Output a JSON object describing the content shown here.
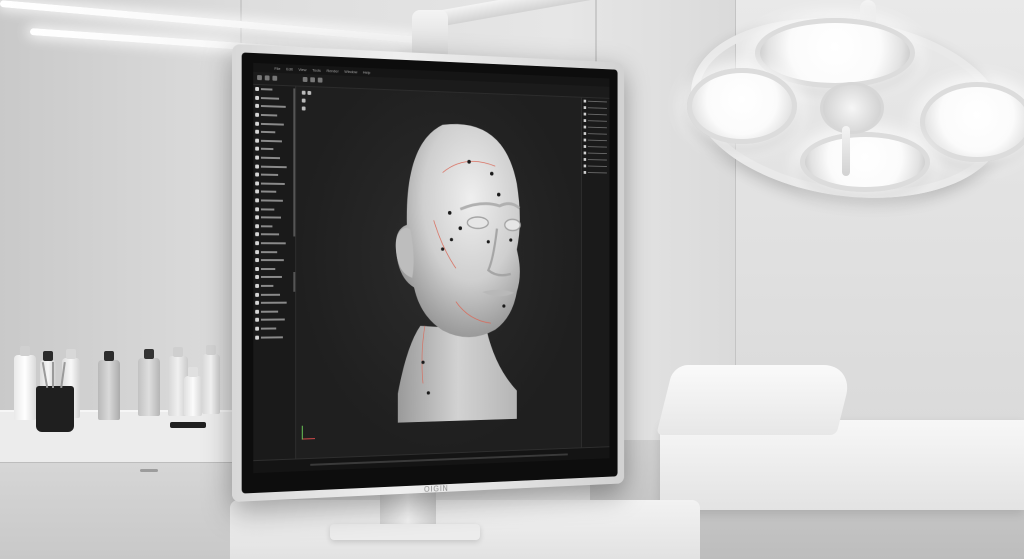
{
  "scene": {
    "colors": {
      "wall": "#e0e0e0",
      "screen_bg": "#232323",
      "head_base": "#d4d4d4",
      "landmark_dot": "#1a1a1a",
      "guide_line": "#d96a5a"
    }
  },
  "monitor": {
    "brand": "OIGIN",
    "menu_items": [
      "File",
      "Edit",
      "View",
      "Tools",
      "Render",
      "Window",
      "Help"
    ],
    "outliner_rows": 30,
    "timeline_label": ""
  },
  "head_model": {
    "landmarks": 12
  }
}
